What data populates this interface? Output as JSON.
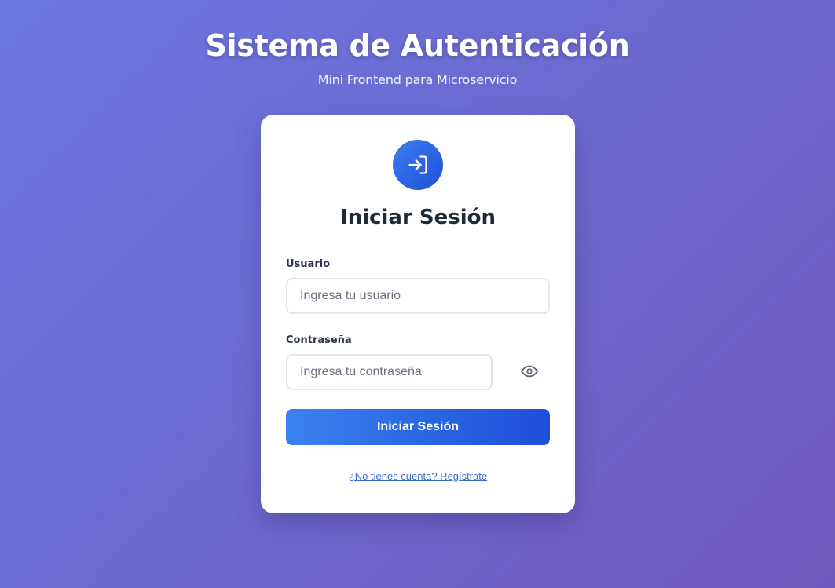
{
  "header": {
    "title": "Sistema de Autenticación",
    "subtitle": "Mini Frontend para Microservicio"
  },
  "login_card": {
    "icon": "login-arrow-icon",
    "title": "Iniciar Sesión",
    "username": {
      "label": "Usuario",
      "value": "",
      "placeholder": "Ingresa tu usuario"
    },
    "password": {
      "label": "Contraseña",
      "value": "",
      "placeholder": "Ingresa tu contraseña",
      "toggle_icon": "eye-icon"
    },
    "submit_label": "Iniciar Sesión",
    "register_link": "¿No tienes cuenta? Regístrate"
  },
  "colors": {
    "background_start": "#6a78e0",
    "background_end": "#7059bd",
    "accent": "#2563eb",
    "link": "#3b6fd4",
    "title_text": "#1f2a37"
  }
}
